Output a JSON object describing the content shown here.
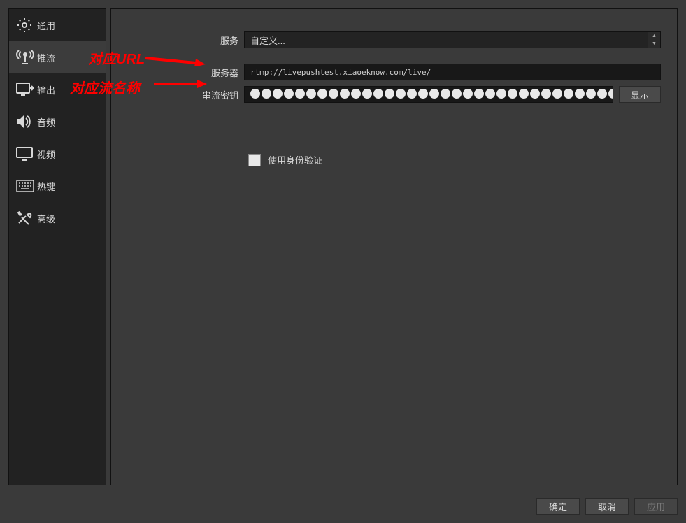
{
  "sidebar": {
    "items": [
      {
        "label": "通用",
        "icon": "gear-icon"
      },
      {
        "label": "推流",
        "icon": "broadcast-icon",
        "selected": true
      },
      {
        "label": "输出",
        "icon": "output-icon"
      },
      {
        "label": "音频",
        "icon": "speaker-icon"
      },
      {
        "label": "视频",
        "icon": "monitor-icon"
      },
      {
        "label": "热键",
        "icon": "keyboard-icon"
      },
      {
        "label": "高级",
        "icon": "tools-icon"
      }
    ]
  },
  "form": {
    "service_label": "服务",
    "service_value": "自定义...",
    "server_label": "服务器",
    "server_value": "rtmp://livepushtest.xiaoeknow.com/live/",
    "streamkey_label": "串流密钥",
    "streamkey_masked_count": 33,
    "show_btn": "显示",
    "auth_label": "使用身份验证"
  },
  "annotations": {
    "url_label": "对应URL",
    "streamname_label": "对应流名称"
  },
  "footer": {
    "ok": "确定",
    "cancel": "取消",
    "apply": "应用"
  }
}
